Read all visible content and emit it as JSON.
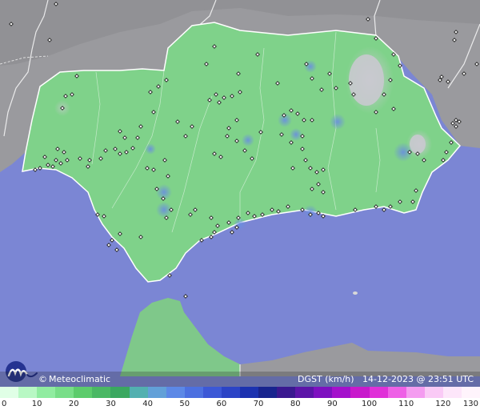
{
  "brand": {
    "copyright_symbol": "©",
    "name": "Meteoclimatic",
    "logo_icon": "meteoclimatic-logo"
  },
  "map_meta": {
    "variable": "DGST",
    "unit": "(km/h)",
    "date": "14-12-2023",
    "at": "@",
    "time": "23:51",
    "timezone": "UTC"
  },
  "legend": {
    "labels": [
      "0",
      "10",
      "20",
      "30",
      "40",
      "50",
      "60",
      "70",
      "80",
      "90",
      "100",
      "110",
      "120",
      "130"
    ],
    "colors": [
      "#e0ffe6",
      "#b8f8c4",
      "#90eca0",
      "#78de88",
      "#5ccc6c",
      "#4ab864",
      "#3aa860",
      "#52b0b0",
      "#62a0d8",
      "#5c88e6",
      "#4c70e0",
      "#3c58d6",
      "#2c44c6",
      "#1c32b0",
      "#18248e",
      "#3a1890",
      "#5c14a8",
      "#7e10c0",
      "#a410cc",
      "#c818cc",
      "#e030d8",
      "#ee60e6",
      "#f49cf0",
      "#facaf6",
      "#fde6fa",
      "#fff4fc"
    ]
  },
  "colors": {
    "sea": "#7b86d4",
    "land": "#7fd28a",
    "mountains": "#c8c8cc",
    "neighbor_land": "#9a9a9e"
  }
}
